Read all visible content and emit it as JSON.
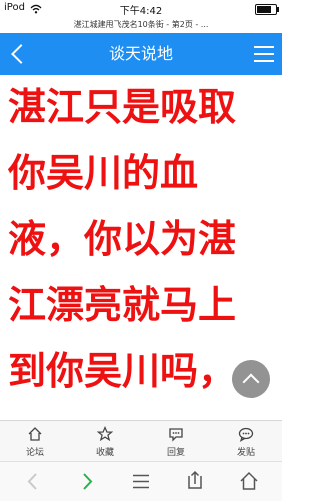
{
  "status": {
    "carrier": "iPod",
    "time": "下午4:42",
    "battery_level": 0.8
  },
  "url": {
    "text": "湛江城建甩飞茂名10条街 - 第2页 - ..."
  },
  "header": {
    "title": "谈天说地"
  },
  "post": {
    "lines": [
      "湛江只是吸取",
      "你吴川的血",
      "液，你以为湛",
      "江漂亮就马上",
      "到你吴川吗，"
    ]
  },
  "tabs": [
    {
      "label": "论坛",
      "icon": "home-icon"
    },
    {
      "label": "收藏",
      "icon": "star-icon"
    },
    {
      "label": "回复",
      "icon": "comment-icon"
    },
    {
      "label": "发贴",
      "icon": "chat-icon"
    }
  ],
  "toolbar": {
    "items": [
      "back-arrow-icon",
      "forward-arrow-icon",
      "menu-icon",
      "share-icon",
      "home-icon"
    ]
  },
  "colors": {
    "accent": "#1e8ef3",
    "post_text": "#ee1111"
  }
}
